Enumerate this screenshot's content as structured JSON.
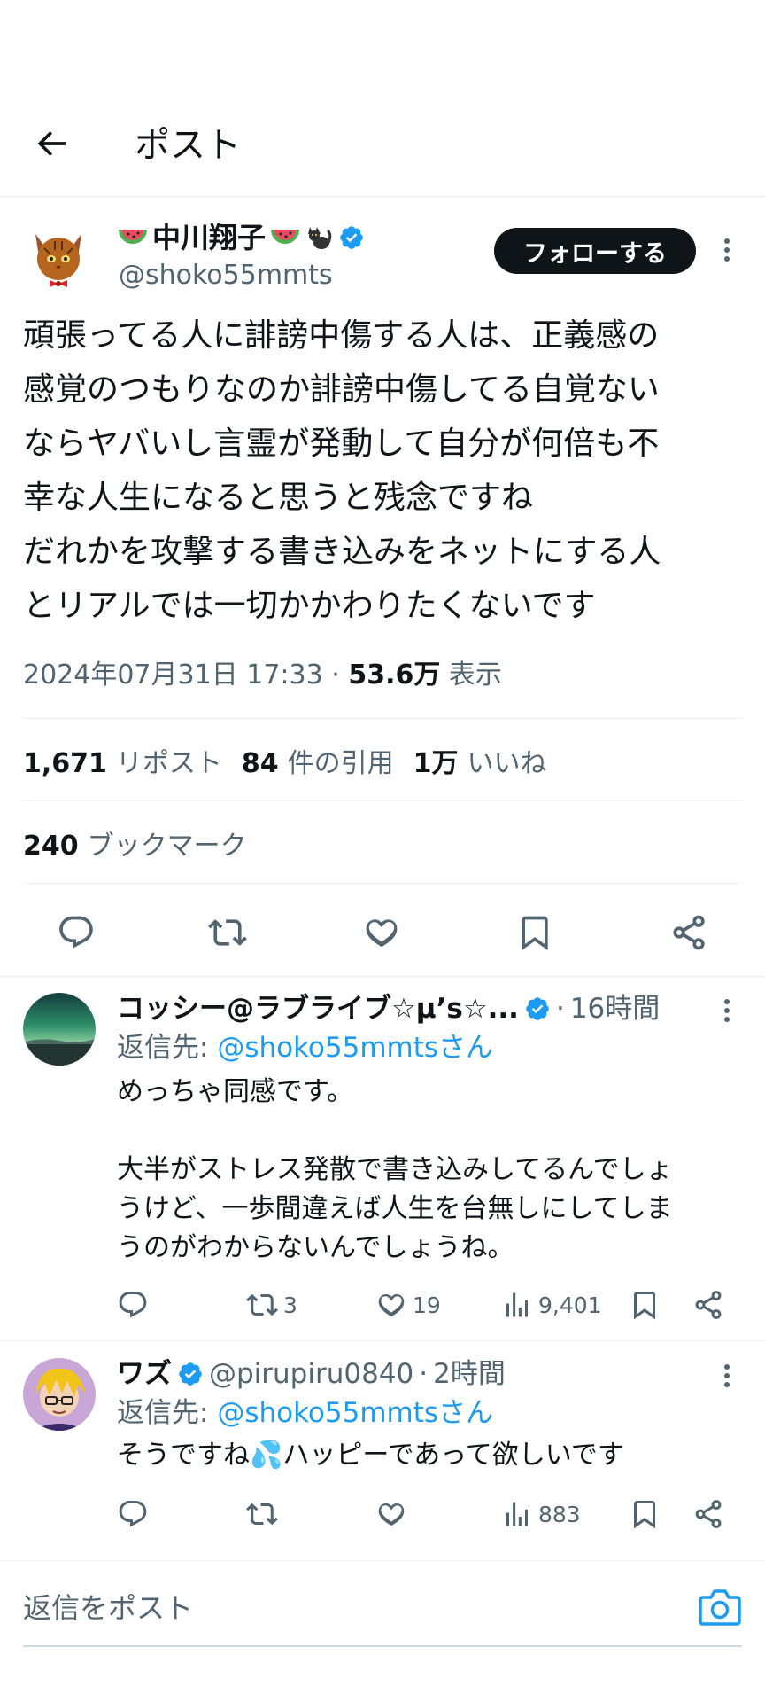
{
  "header": {
    "title": "ポスト"
  },
  "main_post": {
    "author_name": "中川翔子",
    "author_handle": "@shoko55mmts",
    "follow_label": "フォローする",
    "text": "頑張ってる人に誹謗中傷する人は、正義感の\n感覚のつもりなのか誹謗中傷してる自覚ない\nならヤバいし言霊が発動して自分が何倍も不\n幸な人生になると思うと残念ですね\nだれかを攻撃する書き込みをネットにする人\nとリアルでは一切かかわりたくないです",
    "timestamp": "2024年07月31日 17:33",
    "separator": "·",
    "views_count": "53.6万",
    "views_label": "表示",
    "stats": {
      "reposts_count": "1,671",
      "reposts_label": "リポスト",
      "quotes_count": "84",
      "quotes_label": "件の引用",
      "likes_count": "1万",
      "likes_label": "いいね",
      "bookmarks_count": "240",
      "bookmarks_label": "ブックマーク"
    }
  },
  "replies": [
    {
      "author_name": "コッシー@ラブライブ☆μ’s☆...",
      "author_handle": "",
      "separator": "·",
      "time": "16時間",
      "reply_to_prefix": "返信先:",
      "reply_to_handle": "@shoko55mmtsさん",
      "text": "めっちゃ同感です。\n\n大半がストレス発散で書き込みしてるんでしょ\nうけど、一歩間違えば人生を台無しにしてしま\nうのがわからないんでしょうね。",
      "reposts": "3",
      "likes": "19",
      "views": "9,401"
    },
    {
      "author_name": "ワズ",
      "author_handle": "@pirupiru0840",
      "separator": "·",
      "time": "2時間",
      "reply_to_prefix": "返信先:",
      "reply_to_handle": "@shoko55mmtsさん",
      "text": "そうですね💦ハッピーであって欲しいです",
      "reposts": "",
      "likes": "",
      "views": "883"
    }
  ],
  "composer": {
    "placeholder": "返信をポスト"
  },
  "colors": {
    "accent": "#1d9bf0",
    "text": "#0f1419",
    "muted": "#536471",
    "divider": "#eff3f4"
  },
  "icons": [
    "back-arrow-icon",
    "verified-badge-icon",
    "more-icon",
    "reply-icon",
    "repost-icon",
    "like-icon",
    "bookmark-icon",
    "share-icon",
    "views-icon",
    "camera-icon"
  ]
}
